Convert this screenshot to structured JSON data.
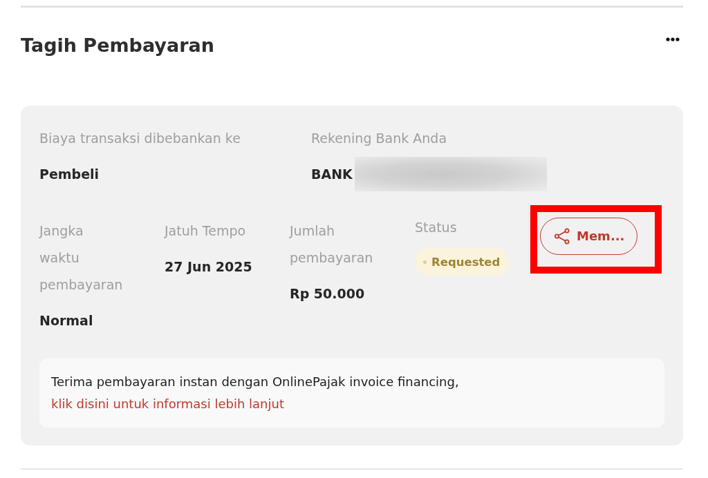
{
  "header": {
    "title": "Tagih Pembayaran"
  },
  "details": {
    "top_fields": [
      {
        "label": "Biaya transaksi dibebankan ke",
        "value": "Pembeli",
        "redacted": false
      },
      {
        "label": "Rekening Bank Anda",
        "value": "BANK",
        "redacted": true
      }
    ],
    "fields": [
      {
        "kind": "text",
        "label": "Jangka waktu pembayaran",
        "value": "Normal"
      },
      {
        "kind": "text",
        "label": "Jatuh Tempo",
        "value": "27 Jun 2025"
      },
      {
        "kind": "text",
        "label": "Jumlah pembayaran",
        "value": "Rp 50.000"
      },
      {
        "kind": "badge",
        "label": "Status",
        "value": "Requested"
      }
    ],
    "share_button": {
      "label": "Mem...",
      "highlighted": true
    }
  },
  "notice": {
    "text": "Terima pembayaran instan dengan OnlinePajak invoice financing,",
    "link": "klik disini untuk informasi lebih lanjut"
  }
}
